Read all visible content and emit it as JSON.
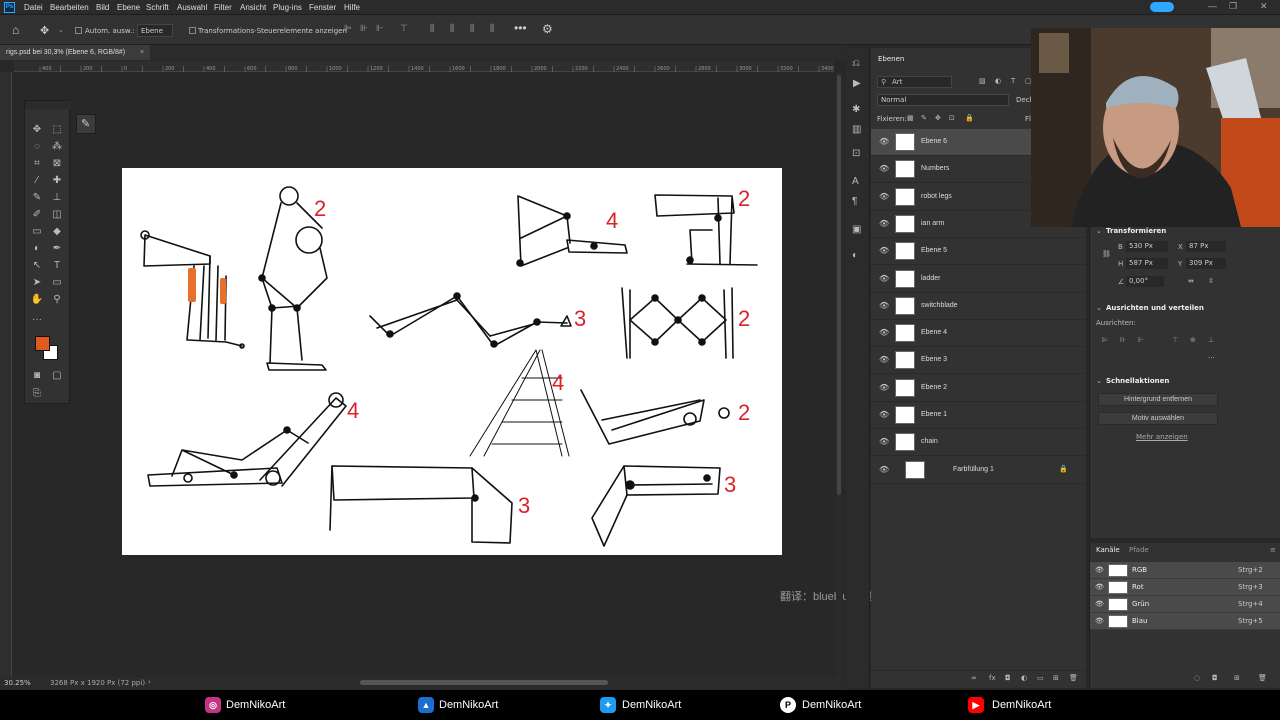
{
  "menubar": {
    "items": [
      "Datei",
      "Bearbeiten",
      "Bild",
      "Ebene",
      "Schrift",
      "Auswahl",
      "Filter",
      "Ansicht",
      "Plug-ins",
      "Fenster",
      "Hilfe"
    ]
  },
  "options": {
    "auto_select": "Autom. ausw.:",
    "target": "Ebene",
    "transform_controls": "Transformations-Steuerelemente anzeigen"
  },
  "document": {
    "tab": "rigs.psd bei 30,3% (Ebene 6, RGB/8#)",
    "zoom": "30.25%",
    "size": "3268 Px x 1920 Px (72 ppi)"
  },
  "ruler_ticks": [
    "400",
    "300",
    "200",
    "100",
    "0",
    "100",
    "200",
    "300",
    "400",
    "500",
    "600",
    "700",
    "800",
    "900",
    "1000",
    "1100",
    "1200",
    "1300",
    "1400",
    "1500",
    "1600",
    "1700",
    "1800",
    "1900",
    "2000",
    "2100",
    "2200",
    "2300",
    "2400",
    "2500",
    "2600",
    "2700",
    "2800",
    "2900",
    "3000",
    "3100",
    "3200",
    "3300",
    "3400"
  ],
  "canvas": {
    "numbers": [
      "2",
      "4",
      "2",
      "3",
      "2",
      "4",
      "2",
      "4",
      "3",
      "3"
    ],
    "watermark": "翻译：blueblur青速"
  },
  "layers_panel": {
    "title": "Ebenen",
    "filter": "Art",
    "blend": "Normal",
    "opacity_label": "Deckr",
    "lock_label": "Fixieren:",
    "fill_label": "Fl",
    "layers": [
      "Ebene 6",
      "Numbers",
      "robot legs",
      "ian arm",
      "Ebene 5",
      "ladder",
      "switchblade",
      "Ebene 4",
      "Ebene 3",
      "Ebene 2",
      "Ebene 1",
      "chain",
      "Farbfüllung 1"
    ]
  },
  "properties": {
    "transform_title": "Transformieren",
    "b_label": "B",
    "b_value": "530 Px",
    "x_label": "X",
    "x_value": "87 Px",
    "h_label": "H",
    "h_value": "587 Px",
    "y_label": "Y",
    "y_value": "309 Px",
    "angle": "0,00°",
    "align_title": "Ausrichten und verteilen",
    "align_to": "Ausrichten:",
    "quick_title": "Schnellaktionen",
    "remove_bg": "Hintergrund entfernen",
    "select_subject": "Motiv auswählen",
    "more": "Mehr anzeigen"
  },
  "channels_panel": {
    "tab_channels": "Kanäle",
    "tab_paths": "Pfade",
    "channels": [
      {
        "name": "RGB",
        "shortcut": "Strg+2"
      },
      {
        "name": "Rot",
        "shortcut": "Strg+3"
      },
      {
        "name": "Grün",
        "shortcut": "Strg+4"
      },
      {
        "name": "Blau",
        "shortcut": "Strg+5"
      }
    ]
  },
  "social": {
    "handles": [
      "DemNikoArt",
      "DemNikoArt",
      "DemNikoArt",
      "DemNikoArt",
      "DemNikoArt"
    ],
    "icons": [
      "instagram-icon",
      "artstation-icon",
      "twitter-icon",
      "patreon-icon",
      "youtube-icon"
    ]
  },
  "colors": {
    "foreground": "#e05a1e",
    "background": "#ffffff",
    "accent": "#31a8ff",
    "orange_marker": "#e8702a",
    "red_number": "#d8232a"
  }
}
